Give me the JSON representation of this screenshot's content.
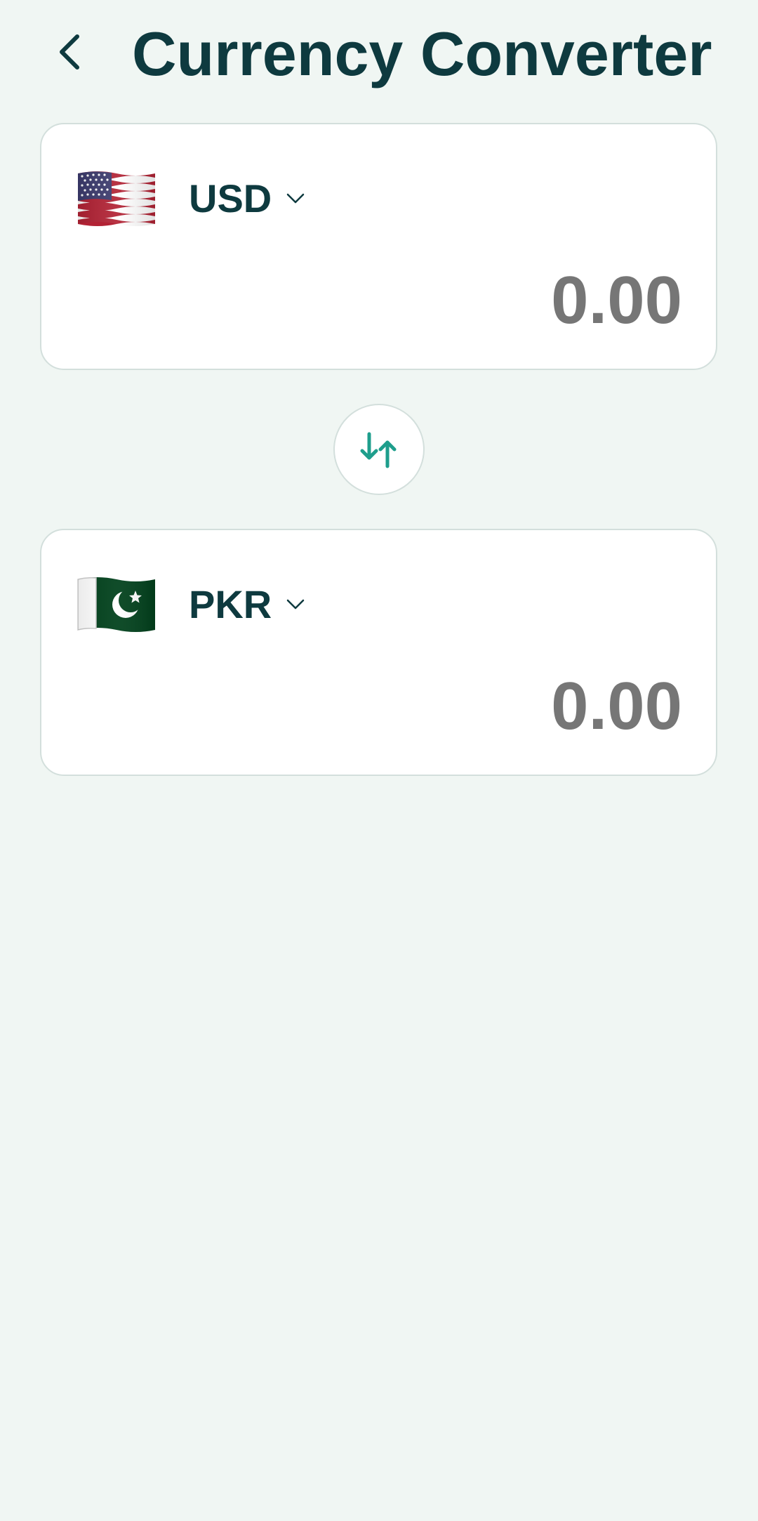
{
  "header": {
    "title": "Currency Converter",
    "back_icon": "chevron-left-icon"
  },
  "from_currency": {
    "flag_icon": "us-flag-icon",
    "code": "USD",
    "dropdown_icon": "chevron-down-icon",
    "amount": "0.00"
  },
  "swap": {
    "icon": "swap-vertical-icon",
    "color": "#1E9E8C"
  },
  "to_currency": {
    "flag_icon": "pakistan-flag-icon",
    "code": "PKR",
    "dropdown_icon": "chevron-down-icon",
    "amount": "0.00"
  },
  "colors": {
    "background": "#F0F6F3",
    "title": "#0E3A3F",
    "amount": "#767676",
    "card_border": "#D3DFDC",
    "accent": "#1E9E8C"
  }
}
